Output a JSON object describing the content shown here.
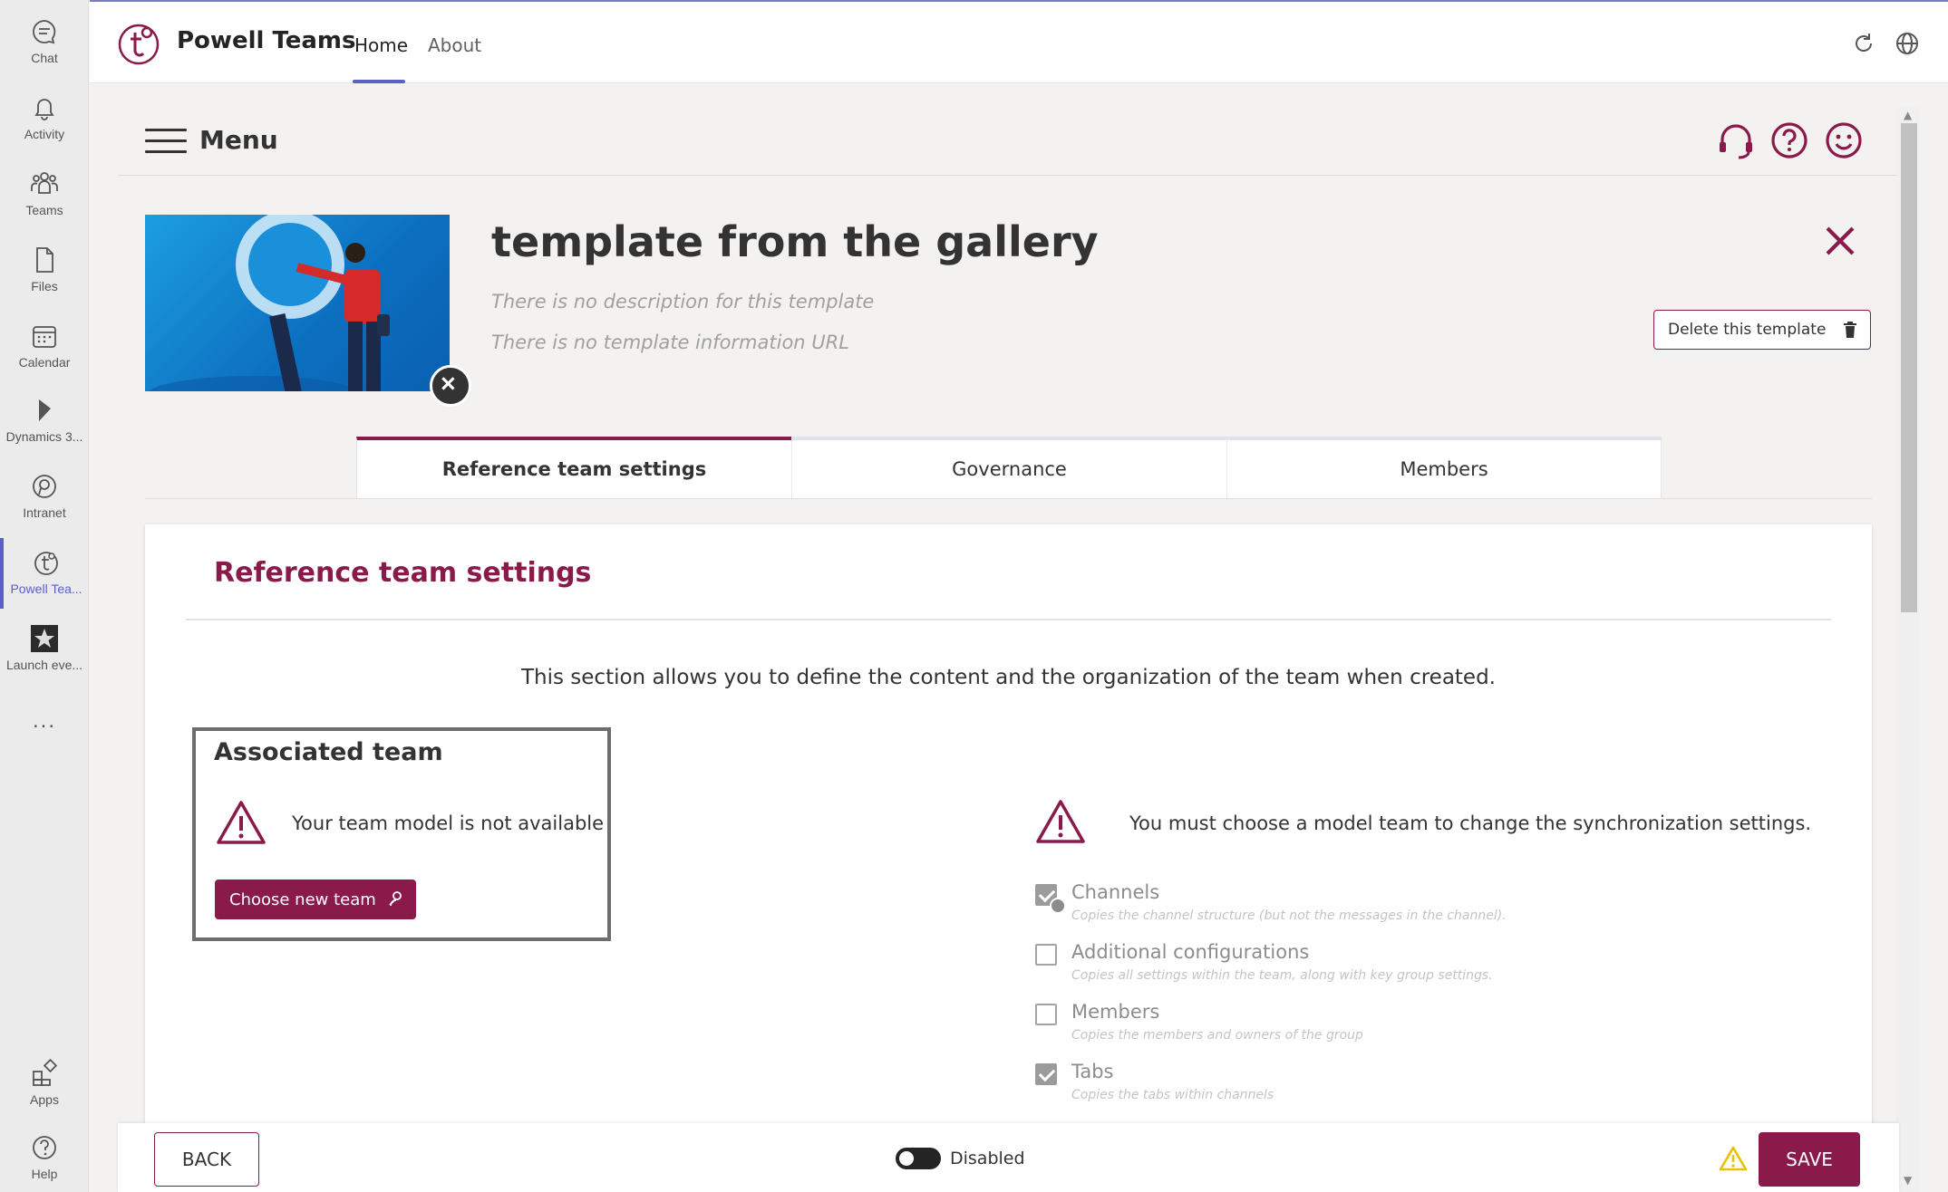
{
  "rail": {
    "items": [
      {
        "label": "Chat",
        "icon": "chat-icon"
      },
      {
        "label": "Activity",
        "icon": "bell-icon"
      },
      {
        "label": "Teams",
        "icon": "teams-icon"
      },
      {
        "label": "Files",
        "icon": "file-icon"
      },
      {
        "label": "Calendar",
        "icon": "calendar-icon"
      },
      {
        "label": "Dynamics 3...",
        "icon": "dynamics-icon"
      },
      {
        "label": "Intranet",
        "icon": "intranet-icon"
      },
      {
        "label": "Powell Tea...",
        "icon": "powell-teams-icon"
      },
      {
        "label": "Launch eve...",
        "icon": "launch-event-icon"
      }
    ],
    "more": "...",
    "apps": "Apps",
    "help": "Help"
  },
  "header": {
    "app_name": "Powell Teams",
    "tabs": [
      "Home",
      "About"
    ],
    "active_tab": "Home"
  },
  "menu": {
    "label": "Menu"
  },
  "template": {
    "title": "template from the gallery",
    "description": "There is no description for this template",
    "info_url": "There is no template information URL",
    "delete_label": "Delete this template"
  },
  "tabs": [
    "Reference team settings",
    "Governance",
    "Members"
  ],
  "active_tab": "Reference team settings",
  "section": {
    "title": "Reference team settings",
    "intro": "This section allows you to define the content and the organization of the team when created.",
    "associated": {
      "title": "Associated team",
      "message": "Your team model is not available",
      "button": "Choose new team"
    },
    "sync_message": "You must choose a model team to change the synchronization settings.",
    "options": [
      {
        "label": "Channels",
        "sub": "Copies the channel structure (but not the messages in the channel).",
        "checked": true,
        "locked": true
      },
      {
        "label": "Additional configurations",
        "sub": "Copies all settings within the team, along with key group settings.",
        "checked": false,
        "locked": false
      },
      {
        "label": "Members",
        "sub": "Copies the members and owners of the group",
        "checked": false,
        "locked": false
      },
      {
        "label": "Tabs",
        "sub": "Copies the tabs within channels",
        "checked": true,
        "locked": false
      }
    ]
  },
  "footer": {
    "back": "BACK",
    "toggle_label": "Disabled",
    "toggle_on": false,
    "save": "SAVE"
  },
  "colors": {
    "accent": "#8a1a4a",
    "teams_purple": "#5b5fc7",
    "warning_yellow": "#e8c100"
  }
}
